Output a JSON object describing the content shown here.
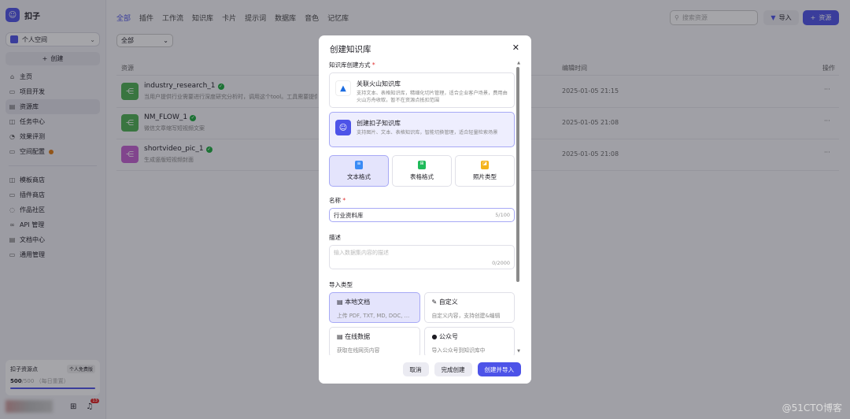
{
  "app": {
    "name": "扣子"
  },
  "sidebar": {
    "space": "个人空间",
    "create": "创建",
    "items": [
      {
        "label": "主页",
        "icon": "⌂"
      },
      {
        "label": "项目开发",
        "icon": "▭"
      },
      {
        "label": "资源库",
        "icon": "▤"
      },
      {
        "label": "任务中心",
        "icon": "◫"
      },
      {
        "label": "效果评测",
        "icon": "◔"
      },
      {
        "label": "空间配置",
        "icon": "▭"
      }
    ],
    "items2": [
      {
        "label": "模板商店",
        "icon": "◫"
      },
      {
        "label": "插件商店",
        "icon": "▭"
      },
      {
        "label": "作品社区",
        "icon": "◌"
      },
      {
        "label": "API 管理",
        "icon": "∞"
      },
      {
        "label": "文档中心",
        "icon": "▤"
      },
      {
        "label": "通用管理",
        "icon": "▭"
      }
    ],
    "points": {
      "title": "扣子资源点",
      "plan": "个人免费版",
      "value": "500",
      "total": "/500",
      "reset": "（每日重置）",
      "fraction": 1.0
    },
    "notification_count": "13"
  },
  "header": {
    "tabs": [
      "全部",
      "插件",
      "工作流",
      "知识库",
      "卡片",
      "提示词",
      "数据库",
      "音色",
      "记忆库"
    ],
    "search_placeholder": "搜索资源",
    "import": "导入",
    "add_resource": "资源",
    "filter": "全部"
  },
  "table": {
    "columns": [
      "资源",
      "编辑时间",
      "操作"
    ],
    "rows": [
      {
        "name": "industry_research_1",
        "desc": "当用户提供行业需要进行深度研究分析时，调用这个tool。工具需要提供行",
        "time": "2025-01-05 21:15",
        "color": "#4caf50"
      },
      {
        "name": "NM_FLOW_1",
        "desc": "微信文章缩写短视频文案",
        "time": "2025-01-05 21:08",
        "color": "#4caf50"
      },
      {
        "name": "shortvideo_pic_1",
        "desc": "生成竖版短视频封面",
        "time": "2025-01-05 21:08",
        "color": "#c45fd0"
      }
    ]
  },
  "modal": {
    "title": "创建知识库",
    "method_label": "知识库创建方式",
    "methods": [
      {
        "title": "关联火山知识库",
        "desc": "支持文本、表格知识库，精细化切片管理，适合企业客户场景，费用由火山方舟收取，暂不在资源点抵扣范围"
      },
      {
        "title": "创建扣子知识库",
        "desc": "支持图片、文本、表格知识库，智能切换管理，适合轻量检索场景"
      }
    ],
    "formats": [
      "文本格式",
      "表格格式",
      "照片类型"
    ],
    "name_label": "名称",
    "name_value": "行业资料库",
    "name_count": "5/100",
    "desc_label": "描述",
    "desc_placeholder": "输入数据集内容的描述",
    "desc_count": "0/2000",
    "import_label": "导入类型",
    "imports": [
      {
        "title": "本地文档",
        "desc": "上传 PDF, TXT, MD, DOC, …",
        "icon": "▤"
      },
      {
        "title": "自定义",
        "desc": "自定义内容，支持创建&编辑",
        "icon": "✎"
      },
      {
        "title": "在线数据",
        "desc": "获取在线网页内容",
        "icon": "▤"
      },
      {
        "title": "公众号",
        "desc": "导入公众号到知识库中",
        "icon": "●"
      }
    ],
    "cancel": "取消",
    "finish": "完成创建",
    "create_import": "创建并导入"
  },
  "watermark": "@51CTO博客"
}
